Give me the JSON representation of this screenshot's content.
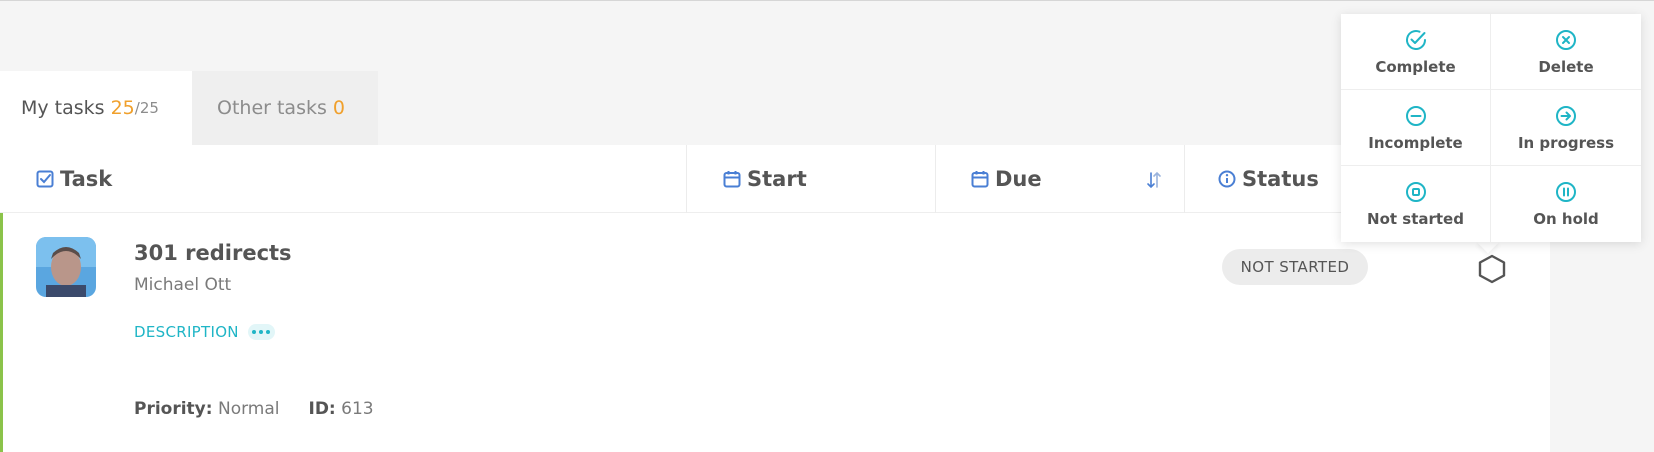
{
  "tabs": {
    "my_tasks": {
      "label": "My tasks",
      "count": "25",
      "total": "/25"
    },
    "other_tasks": {
      "label": "Other tasks",
      "count": "0"
    }
  },
  "columns": {
    "task": "Task",
    "start": "Start",
    "due": "Due",
    "status": "Status"
  },
  "task": {
    "title": "301 redirects",
    "assignee": "Michael Ott",
    "description_label": "DESCRIPTION",
    "priority_label": "Priority:",
    "priority": "Normal",
    "id_label": "ID:",
    "id": "613",
    "status": "NOT STARTED"
  },
  "status_menu": [
    {
      "label": "Complete",
      "icon": "check-circle-icon"
    },
    {
      "label": "Delete",
      "icon": "x-circle-icon"
    },
    {
      "label": "Incomplete",
      "icon": "minus-circle-icon"
    },
    {
      "label": "In progress",
      "icon": "arrow-right-circle-icon"
    },
    {
      "label": "Not started",
      "icon": "stop-circle-icon"
    },
    {
      "label": "On hold",
      "icon": "pause-circle-icon"
    }
  ],
  "colors": {
    "accent": "#1fb5c6",
    "count": "#f0a02c",
    "row_indicator": "#8bc34a",
    "header_icon": "#4a7fd4"
  }
}
